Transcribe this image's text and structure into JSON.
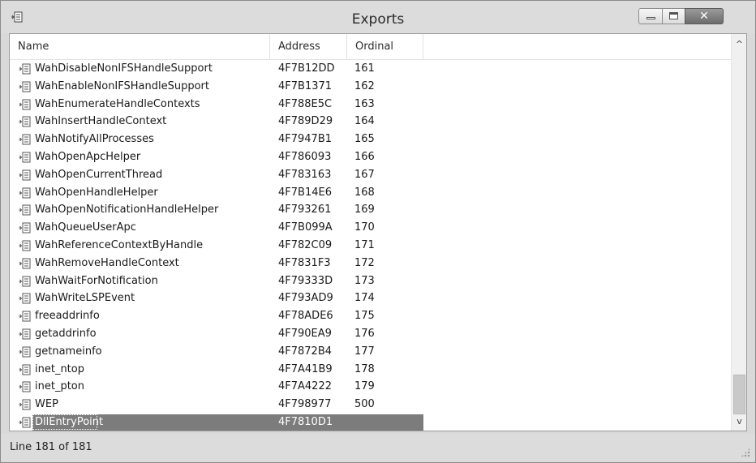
{
  "window": {
    "title": "Exports",
    "app_icon": "exports-icon",
    "controls": {
      "minimize_icon": "minimize-icon",
      "maximize_icon": "maximize-icon",
      "close_icon": "close-icon",
      "close_glyph": "✕"
    }
  },
  "table": {
    "columns": [
      "Name",
      "Address",
      "Ordinal"
    ],
    "row_icon": "export-function-icon",
    "rows": [
      {
        "name": "WahDisableNonIFSHandleSupport",
        "address": "4F7B12DD",
        "ordinal": "161"
      },
      {
        "name": "WahEnableNonIFSHandleSupport",
        "address": "4F7B1371",
        "ordinal": "162"
      },
      {
        "name": "WahEnumerateHandleContexts",
        "address": "4F788E5C",
        "ordinal": "163"
      },
      {
        "name": "WahInsertHandleContext",
        "address": "4F789D29",
        "ordinal": "164"
      },
      {
        "name": "WahNotifyAllProcesses",
        "address": "4F7947B1",
        "ordinal": "165"
      },
      {
        "name": "WahOpenApcHelper",
        "address": "4F786093",
        "ordinal": "166"
      },
      {
        "name": "WahOpenCurrentThread",
        "address": "4F783163",
        "ordinal": "167"
      },
      {
        "name": "WahOpenHandleHelper",
        "address": "4F7B14E6",
        "ordinal": "168"
      },
      {
        "name": "WahOpenNotificationHandleHelper",
        "address": "4F793261",
        "ordinal": "169"
      },
      {
        "name": "WahQueueUserApc",
        "address": "4F7B099A",
        "ordinal": "170"
      },
      {
        "name": "WahReferenceContextByHandle",
        "address": "4F782C09",
        "ordinal": "171"
      },
      {
        "name": "WahRemoveHandleContext",
        "address": "4F7831F3",
        "ordinal": "172"
      },
      {
        "name": "WahWaitForNotification",
        "address": "4F79333D",
        "ordinal": "173"
      },
      {
        "name": "WahWriteLSPEvent",
        "address": "4F793AD9",
        "ordinal": "174"
      },
      {
        "name": "freeaddrinfo",
        "address": "4F78ADE6",
        "ordinal": "175"
      },
      {
        "name": "getaddrinfo",
        "address": "4F790EA9",
        "ordinal": "176"
      },
      {
        "name": "getnameinfo",
        "address": "4F7872B4",
        "ordinal": "177"
      },
      {
        "name": "inet_ntop",
        "address": "4F7A41B9",
        "ordinal": "178"
      },
      {
        "name": "inet_pton",
        "address": "4F7A4222",
        "ordinal": "179"
      },
      {
        "name": "WEP",
        "address": "4F798977",
        "ordinal": "500"
      },
      {
        "name": "DllEntryPoint",
        "address": "4F7810D1",
        "ordinal": "",
        "selected": true
      }
    ]
  },
  "scrollbar": {
    "up_glyph": "^",
    "down_glyph": "v",
    "position": 1.0
  },
  "statusbar": {
    "text": "Line 181 of 181"
  },
  "colors": {
    "selection": "#7c7c7c",
    "chrome": "#dcdcdc"
  }
}
